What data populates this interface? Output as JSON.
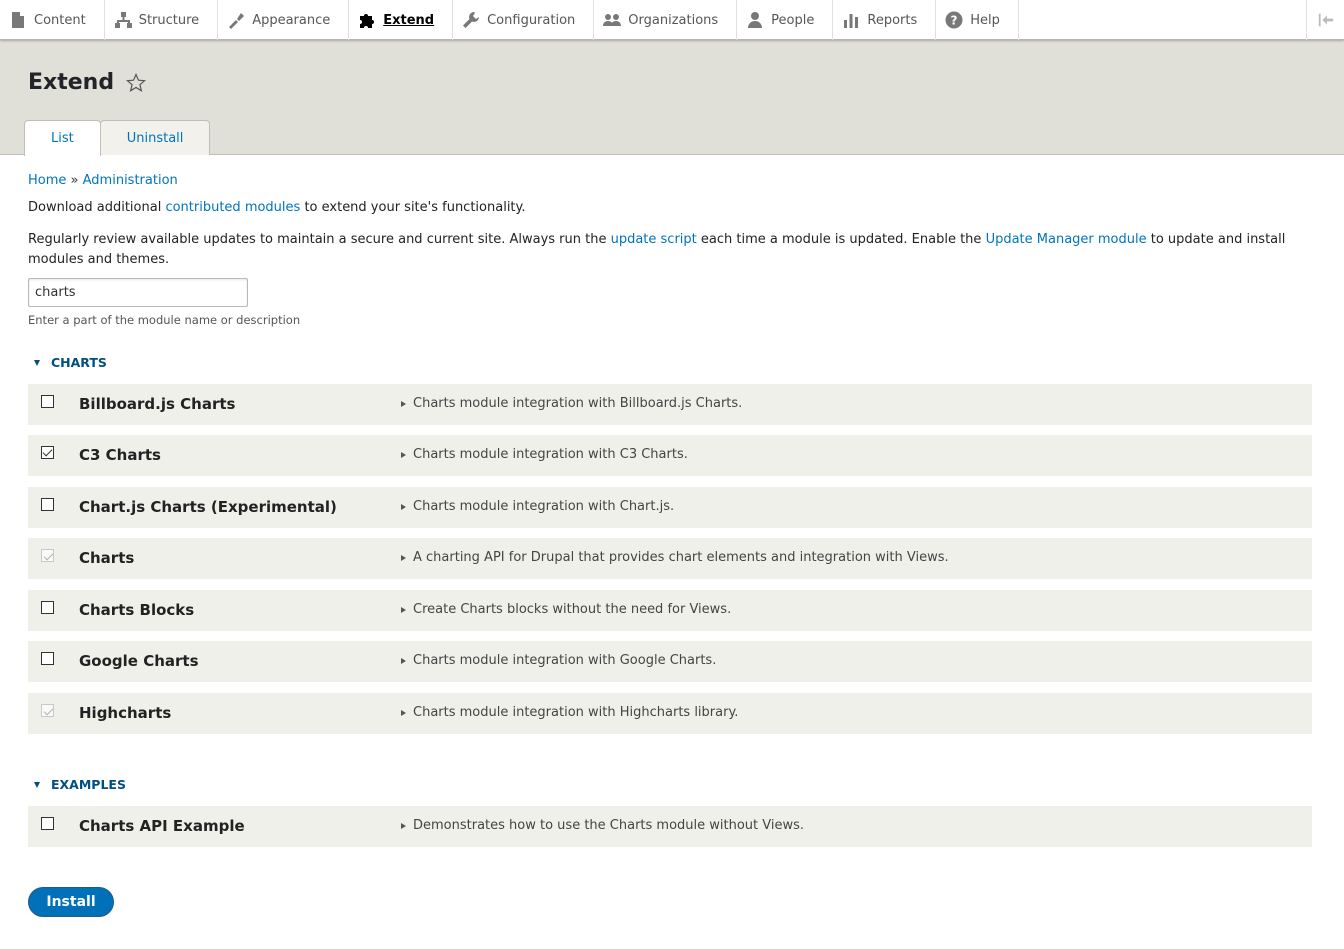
{
  "toolbar": {
    "items": [
      {
        "label": "Content",
        "icon": "file-icon"
      },
      {
        "label": "Structure",
        "icon": "sitemap-icon"
      },
      {
        "label": "Appearance",
        "icon": "paintbrush-icon"
      },
      {
        "label": "Extend",
        "icon": "puzzle-icon",
        "active": true
      },
      {
        "label": "Configuration",
        "icon": "wrench-icon"
      },
      {
        "label": "Organizations",
        "icon": "group-icon"
      },
      {
        "label": "People",
        "icon": "person-icon"
      },
      {
        "label": "Reports",
        "icon": "bar-chart-icon"
      },
      {
        "label": "Help",
        "icon": "question-icon"
      }
    ]
  },
  "header": {
    "title": "Extend",
    "tabs": [
      {
        "label": "List",
        "active": true
      },
      {
        "label": "Uninstall",
        "active": false
      }
    ]
  },
  "breadcrumb": {
    "home": "Home",
    "separator": "»",
    "admin": "Administration"
  },
  "intro": {
    "p1_before": "Download additional ",
    "p1_link": "contributed modules",
    "p1_after": " to extend your site's functionality.",
    "p2_a": "Regularly review available updates to maintain a secure and current site. Always run the ",
    "p2_link1": "update script",
    "p2_b": " each time a module is updated. Enable the ",
    "p2_link2": "Update Manager module",
    "p2_c": " to update and install modules and themes."
  },
  "filter": {
    "value": "charts",
    "description": "Enter a part of the module name or description"
  },
  "packages": [
    {
      "name": "CHARTS",
      "modules": [
        {
          "name": "Billboard.js Charts",
          "description": "Charts module integration with Billboard.js Charts.",
          "state": "unchecked"
        },
        {
          "name": "C3 Charts",
          "description": "Charts module integration with C3 Charts.",
          "state": "checked"
        },
        {
          "name": "Chart.js Charts (Experimental)",
          "description": "Charts module integration with Chart.js.",
          "state": "unchecked"
        },
        {
          "name": "Charts",
          "description": "A charting API for Drupal that provides chart elements and integration with Views.",
          "state": "disabled-checked"
        },
        {
          "name": "Charts Blocks",
          "description": "Create Charts blocks without the need for Views.",
          "state": "unchecked"
        },
        {
          "name": "Google Charts",
          "description": "Charts module integration with Google Charts.",
          "state": "unchecked"
        },
        {
          "name": "Highcharts",
          "description": "Charts module integration with Highcharts library.",
          "state": "disabled-checked"
        }
      ]
    },
    {
      "name": "EXAMPLES",
      "modules": [
        {
          "name": "Charts API Example",
          "description": "Demonstrates how to use the Charts module without Views.",
          "state": "unchecked"
        }
      ]
    }
  ],
  "actions": {
    "install_label": "Install"
  },
  "colors": {
    "link": "#0074bd",
    "header_bg": "#e0e0d8",
    "row_bg": "#f0f0eb",
    "primary_button": "#0071b8"
  }
}
